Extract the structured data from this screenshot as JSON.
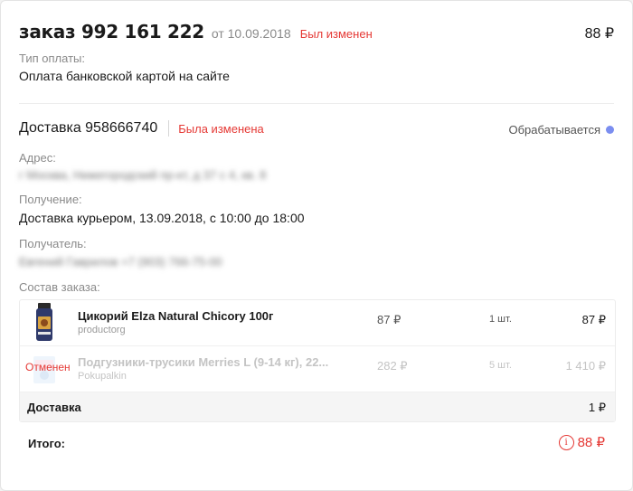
{
  "order": {
    "title": "заказ 992 161 222",
    "date": "от 10.09.2018",
    "changed": "Был изменен",
    "total": "88 ₽"
  },
  "payment": {
    "label": "Тип оплаты:",
    "value": "Оплата банковской картой на сайте"
  },
  "delivery": {
    "title": "Доставка 958666740",
    "changed": "Была изменена",
    "status": "Обрабатывается",
    "address_label": "Адрес:",
    "address_value": "г Москва, Нижегородский пр-кт, д 37 с 4, кв. 8",
    "receive_label": "Получение:",
    "receive_value": "Доставка курьером, 13.09.2018, с 10:00 до 18:00",
    "recipient_label": "Получатель:",
    "recipient_value": "Евгений Гаврилов +7 (903) 766-75-00",
    "composition_label": "Состав заказа:"
  },
  "items": [
    {
      "name": "Цикорий Elza Natural Chicory 100г",
      "seller": "productorg",
      "price": "87 ₽",
      "qty": "1 шт.",
      "sum": "87 ₽"
    },
    {
      "name": "Подгузники-трусики Merries L (9-14 кг), 22...",
      "seller": "Pokupalkin",
      "price": "282 ₽",
      "qty": "5 шт.",
      "sum": "1 410 ₽",
      "cancel_tag": "Отменен"
    }
  ],
  "delivery_row": {
    "label": "Доставка",
    "sum": "1 ₽"
  },
  "total": {
    "label": "Итого:",
    "info": "i",
    "value": "88 ₽"
  },
  "colors": {
    "accent_red": "#e53935",
    "status_dot": "#7b8ef0"
  }
}
